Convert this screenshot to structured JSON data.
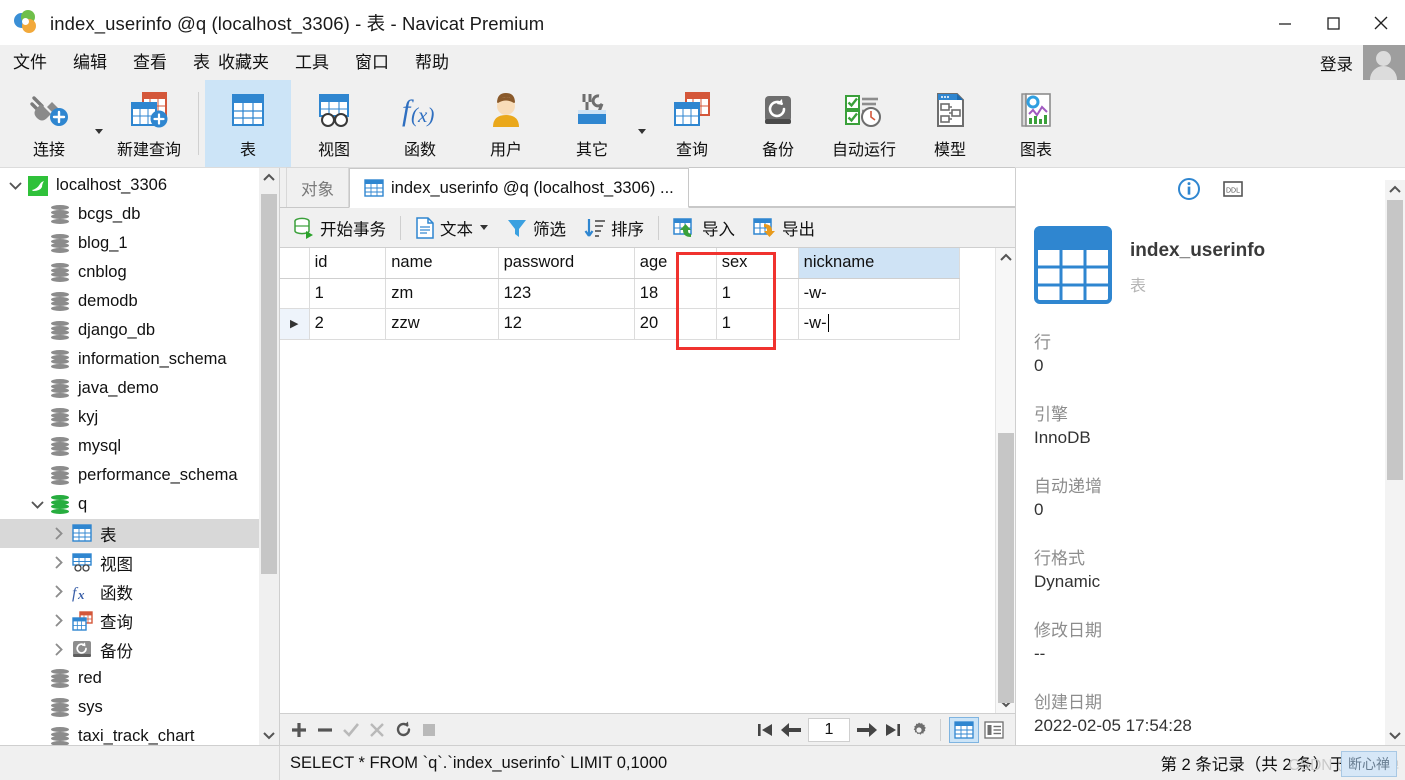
{
  "window": {
    "title": "index_userinfo @q (localhost_3306) - 表 - Navicat Premium",
    "app_icon": "navicat-logo-icon",
    "minimize": "minimize-icon",
    "maximize": "maximize-icon",
    "close": "close-icon"
  },
  "menubar": {
    "items": [
      {
        "label": "文件"
      },
      {
        "label": "编辑"
      },
      {
        "label": "查看"
      },
      {
        "label": "表"
      },
      {
        "label": "收藏夹"
      },
      {
        "label": "工具"
      },
      {
        "label": "窗口"
      },
      {
        "label": "帮助"
      }
    ],
    "login_label": "登录",
    "avatar": "user-avatar-icon"
  },
  "ribbon": {
    "buttons": [
      {
        "label": "连接",
        "icon": "connection-plug-icon",
        "selected": false,
        "caret": true
      },
      {
        "label": "新建查询",
        "icon": "new-query-icon",
        "selected": false,
        "caret": false
      },
      {
        "label": "表",
        "icon": "table-icon",
        "selected": true,
        "caret": false
      },
      {
        "label": "视图",
        "icon": "view-icon",
        "selected": false,
        "caret": false
      },
      {
        "label": "函数",
        "icon": "function-fx-icon",
        "selected": false,
        "caret": false
      },
      {
        "label": "用户",
        "icon": "user-icon",
        "selected": false,
        "caret": false
      },
      {
        "label": "其它",
        "icon": "other-tools-icon",
        "selected": false,
        "caret": true
      },
      {
        "label": "查询",
        "icon": "query-icon",
        "selected": false,
        "caret": false
      },
      {
        "label": "备份",
        "icon": "backup-icon",
        "selected": false,
        "caret": false
      },
      {
        "label": "自动运行",
        "icon": "automation-icon",
        "selected": false,
        "caret": false
      },
      {
        "label": "模型",
        "icon": "model-icon",
        "selected": false,
        "caret": false
      },
      {
        "label": "图表",
        "icon": "chart-icon",
        "selected": false,
        "caret": false
      }
    ]
  },
  "sidebar": {
    "nodes": [
      {
        "label": "localhost_3306",
        "level": 0,
        "icon": "mysql-server-icon",
        "twisty": "down",
        "selected": false
      },
      {
        "label": "bcgs_db",
        "level": 1,
        "icon": "database-icon",
        "twisty": "none",
        "selected": false
      },
      {
        "label": "blog_1",
        "level": 1,
        "icon": "database-icon",
        "twisty": "none",
        "selected": false
      },
      {
        "label": "cnblog",
        "level": 1,
        "icon": "database-icon",
        "twisty": "none",
        "selected": false
      },
      {
        "label": "demodb",
        "level": 1,
        "icon": "database-icon",
        "twisty": "none",
        "selected": false
      },
      {
        "label": "django_db",
        "level": 1,
        "icon": "database-icon",
        "twisty": "none",
        "selected": false
      },
      {
        "label": "information_schema",
        "level": 1,
        "icon": "database-icon",
        "twisty": "none",
        "selected": false
      },
      {
        "label": "java_demo",
        "level": 1,
        "icon": "database-icon",
        "twisty": "none",
        "selected": false
      },
      {
        "label": "kyj",
        "level": 1,
        "icon": "database-icon",
        "twisty": "none",
        "selected": false
      },
      {
        "label": "mysql",
        "level": 1,
        "icon": "database-icon",
        "twisty": "none",
        "selected": false
      },
      {
        "label": "performance_schema",
        "level": 1,
        "icon": "database-icon",
        "twisty": "none",
        "selected": false
      },
      {
        "label": "q",
        "level": 1,
        "icon": "database-open-icon",
        "twisty": "down",
        "selected": false
      },
      {
        "label": "表",
        "level": 2,
        "icon": "table-icon",
        "twisty": "right",
        "selected": true
      },
      {
        "label": "视图",
        "level": 2,
        "icon": "view-icon",
        "twisty": "right",
        "selected": false
      },
      {
        "label": "函数",
        "level": 2,
        "icon": "function-fx-icon",
        "twisty": "right",
        "selected": false
      },
      {
        "label": "查询",
        "level": 2,
        "icon": "query-icon",
        "twisty": "right",
        "selected": false
      },
      {
        "label": "备份",
        "level": 2,
        "icon": "backup-icon",
        "twisty": "right",
        "selected": false
      },
      {
        "label": "red",
        "level": 1,
        "icon": "database-icon",
        "twisty": "none",
        "selected": false
      },
      {
        "label": "sys",
        "level": 1,
        "icon": "database-icon",
        "twisty": "none",
        "selected": false
      },
      {
        "label": "taxi_track_chart",
        "level": 1,
        "icon": "database-icon",
        "twisty": "none",
        "selected": false
      }
    ]
  },
  "tabs": [
    {
      "label": "对象",
      "active": false,
      "icon": null
    },
    {
      "label": "index_userinfo @q (localhost_3306) ...",
      "active": true,
      "icon": "table-icon"
    }
  ],
  "grid_toolbar": [
    {
      "label": "开始事务",
      "icon": "begin-transaction-icon",
      "caret": false
    },
    {
      "label": "文本",
      "icon": "text-icon",
      "caret": true
    },
    {
      "label": "筛选",
      "icon": "filter-icon",
      "caret": false
    },
    {
      "label": "排序",
      "icon": "sort-icon",
      "caret": false
    },
    {
      "label": "导入",
      "icon": "import-icon",
      "caret": false
    },
    {
      "label": "导出",
      "icon": "export-icon",
      "caret": false
    }
  ],
  "grid": {
    "columns": [
      {
        "name": "id",
        "selected": false,
        "align": "right"
      },
      {
        "name": "name",
        "selected": false,
        "align": "left"
      },
      {
        "name": "password",
        "selected": false,
        "align": "left"
      },
      {
        "name": "age",
        "selected": false,
        "align": "right"
      },
      {
        "name": "sex",
        "selected": false,
        "align": "left"
      },
      {
        "name": "nickname",
        "selected": true,
        "align": "left"
      }
    ],
    "rows": [
      {
        "marker": "",
        "current": false,
        "cells": [
          "1",
          "zm",
          "123",
          "18",
          "1",
          "-w-"
        ]
      },
      {
        "marker": "▶",
        "current": true,
        "cells": [
          "2",
          "zzw",
          "12",
          "20",
          "1",
          "-w-"
        ]
      }
    ],
    "editing_cell": {
      "row": 1,
      "column": "nickname",
      "value": "-w-",
      "caret": true
    },
    "highlight_box": {
      "color": "#f0322e",
      "around": "nickname-column"
    }
  },
  "bottom_toolbar": {
    "record_buttons": [
      {
        "icon": "add-record-icon",
        "enabled": true
      },
      {
        "icon": "remove-record-icon",
        "enabled": true
      },
      {
        "icon": "apply-check-icon",
        "enabled": false
      },
      {
        "icon": "cancel-x-icon",
        "enabled": false
      },
      {
        "icon": "refresh-icon",
        "enabled": true
      },
      {
        "icon": "stop-icon",
        "enabled": false
      }
    ],
    "nav_buttons": [
      {
        "icon": "first-page-icon"
      },
      {
        "icon": "prev-page-icon"
      },
      {
        "icon": "next-page-icon"
      },
      {
        "icon": "last-page-icon"
      },
      {
        "icon": "settings-gear-icon"
      }
    ],
    "page_value": "1",
    "view_modes": [
      {
        "icon": "grid-view-icon",
        "selected": true
      },
      {
        "icon": "form-view-icon",
        "selected": false
      }
    ]
  },
  "info_panel": {
    "tabs": [
      {
        "icon": "info-circle-icon",
        "selected": true
      },
      {
        "icon": "ddl-icon",
        "selected": false
      }
    ],
    "object_icon": "table-icon",
    "object_name": "index_userinfo",
    "object_type": "表",
    "properties": [
      {
        "key": "行",
        "value": "0"
      },
      {
        "key": "引擎",
        "value": "InnoDB"
      },
      {
        "key": "自动递增",
        "value": "0"
      },
      {
        "key": "行格式",
        "value": "Dynamic"
      },
      {
        "key": "修改日期",
        "value": "--"
      },
      {
        "key": "创建日期",
        "value": "2022-02-05 17:54:28"
      }
    ]
  },
  "statusbar": {
    "sql": "SELECT * FROM `q`.`index_userinfo` LIMIT 0,1000",
    "record_info": "第 2 条记录（共 2 条）于第 1 页",
    "watermark": "CSDN @断心禅",
    "watermark_badge": "断心禅"
  },
  "colors": {
    "accent_blue": "#2f86d0",
    "selection_blue": "#cce4f7",
    "highlight_red": "#f0322e",
    "chrome_gray": "#f0f0f0"
  }
}
